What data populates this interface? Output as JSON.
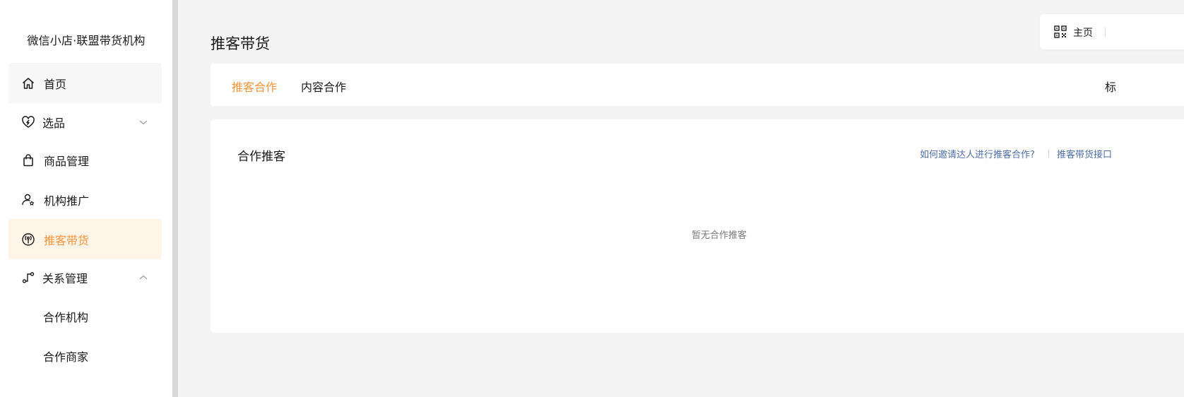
{
  "sidebar": {
    "brand": "微信小店·联盟带货机构",
    "items": [
      {
        "label": "首页",
        "icon": "home-icon"
      },
      {
        "label": "选品",
        "icon": "heart-tag-icon"
      },
      {
        "label": "商品管理",
        "icon": "shopping-bag-icon"
      },
      {
        "label": "机构推广",
        "icon": "user-star-icon"
      },
      {
        "label": "推客带货",
        "icon": "broadcast-icon"
      },
      {
        "label": "关系管理",
        "icon": "relation-icon"
      },
      {
        "label": "合作机构"
      },
      {
        "label": "合作商家"
      }
    ]
  },
  "header": {
    "title": "推客带货",
    "home_label": "主页"
  },
  "tabs": [
    {
      "label": "推客合作"
    },
    {
      "label": "内容合作"
    }
  ],
  "tabs_cut_text": "标",
  "section": {
    "title": "合作推客",
    "help_link": "如何邀请达人进行推客合作?",
    "api_link": "推客带货接口",
    "empty_text": "暂无合作推客"
  },
  "colors": {
    "accent": "#f5953a",
    "active_bg": "#fff4e8",
    "link": "#4f6ea8"
  }
}
